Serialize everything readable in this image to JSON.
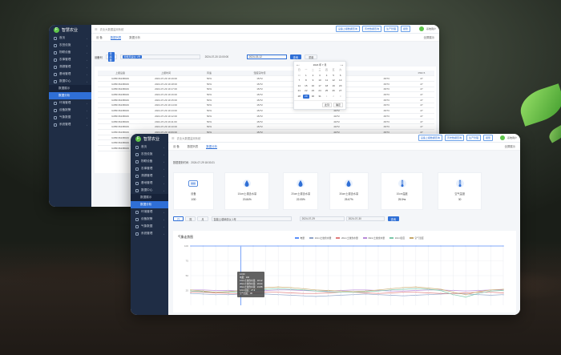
{
  "app": {
    "title": "智慧农业",
    "logo_letter": "F",
    "crumb": "农业大数据监测系统",
    "user": "系统用户",
    "fullscreen": "全屏展示"
  },
  "toolbar": [
    "设备上报数据查询",
    "历史数据查询",
    "生产管理",
    "报警"
  ],
  "menu": [
    {
      "label": "首页"
    },
    {
      "label": "农田设施"
    },
    {
      "label": "物联设备"
    },
    {
      "label": "农事管理"
    },
    {
      "label": "溯源管理"
    },
    {
      "label": "基地管理"
    },
    {
      "label": "数据中心",
      "expanded": true
    }
  ],
  "menu_sub": [
    {
      "label": "数据展示"
    },
    {
      "label": "数据分析",
      "active": true
    }
  ],
  "menu_after": [
    {
      "label": "环境管理"
    },
    {
      "label": "设备报警"
    },
    {
      "label": "气象数据"
    },
    {
      "label": "系统管理"
    }
  ],
  "back": {
    "tabs": [
      "设 备",
      "数据列表",
      "数据分析"
    ],
    "filter": {
      "device_label": "设备列",
      "device_tag": "传感器",
      "device_value": "智能风速仪 1号",
      "start": "2024-07-20 13:00:00",
      "end": "2024-03-12",
      "search": "查询",
      "reset": "重置"
    },
    "calendar": {
      "month": "2024 年 7 月",
      "weekdays": [
        "日",
        "一",
        "二",
        "三",
        "四",
        "五",
        "六"
      ],
      "days": [
        "30",
        "1",
        "2",
        "3",
        "4",
        "5",
        "6",
        "7",
        "8",
        "9",
        "10",
        "11",
        "12",
        "13",
        "14",
        "15",
        "16",
        "17",
        "18",
        "19",
        "20",
        "21",
        "22",
        "23",
        "24",
        "25",
        "26",
        "27",
        "28",
        "29",
        "30",
        "31",
        "1",
        "2",
        "3"
      ],
      "current": "29",
      "buttons": [
        "此刻",
        "确定"
      ]
    },
    "columns": [
      "上报设备",
      "上报时间",
      "风速",
      "湿度实时值",
      "",
      "风向实时值",
      "",
      "PM2.5"
    ],
    "rows": [
      [
        "GXBF3623B029",
        "2024-07-29 19:19:00",
        "50%",
        "15/72",
        "",
        "40/72",
        "15/73",
        "27"
      ],
      [
        "GXBF3623B029",
        "2024-07-29 19:18:00",
        "50%",
        "15/72",
        "",
        "40/72",
        "15/73",
        "27"
      ],
      [
        "GXBF3623B029",
        "2024-07-29 19:17:00",
        "50%",
        "15/72",
        "",
        "40/72",
        "15/73",
        "27"
      ],
      [
        "GXBF3623B029",
        "2024-07-29 19:16:00",
        "50%",
        "15/72",
        "",
        "40/72",
        "15/73",
        "27"
      ],
      [
        "GXBF3623B029",
        "2024-07-29 19:15:00",
        "50%",
        "15/72",
        "",
        "40/72",
        "15/73",
        "27"
      ],
      [
        "GXBF3623B029",
        "2024-07-29 19:14:00",
        "50%",
        "15/72",
        "",
        "40/72",
        "15/73",
        "27"
      ],
      [
        "GXBF3623B029",
        "2024-07-29 19:13:00",
        "50%",
        "15/72",
        "",
        "40/72",
        "15/73",
        "27"
      ],
      [
        "GXBF3623B029",
        "2024-07-29 19:12:00",
        "50%",
        "15/72",
        "",
        "40/72",
        "15/73",
        "27"
      ],
      [
        "GXBF3623B029",
        "2024-07-29 19:11:00",
        "50%",
        "15/72",
        "",
        "40/72",
        "15/73",
        "27"
      ],
      [
        "GXBF3623B029",
        "2024-07-29 19:10:00",
        "50%",
        "15/72",
        "",
        "40/72",
        "15/73",
        "27"
      ],
      [
        "GXBF3623B029",
        "2024-07-29 19:09:00",
        "50%",
        "15/72",
        "",
        "40/72",
        "15/73",
        "27"
      ],
      [
        "GXBF3623B029",
        "2024-07-29 19:08:00",
        "50%",
        "15/72",
        "",
        "40/72",
        "15/73",
        "27"
      ],
      [
        "GXBF3623B029",
        "2024-07-29 19:07:00",
        "50%",
        "15/72",
        "",
        "40/72",
        "15/73",
        "27"
      ],
      [
        "GXBF3623B029",
        "2024-07-29 19:06:00",
        "50%",
        "15/72",
        "",
        "40/72",
        "15/73",
        "27"
      ]
    ]
  },
  "front": {
    "tabs": [
      "设 备",
      "数据列表",
      "数据分析"
    ],
    "updated": "数据更新时间：2024-07-29 18:30:21",
    "cards": [
      {
        "icon": "device-icon",
        "label": "设备",
        "value": "1/30"
      },
      {
        "icon": "drop-icon",
        "label": "10cm土壤含水量",
        "value": "20.84%"
      },
      {
        "icon": "drop-icon",
        "label": "20cm土壤含水量",
        "value": "22.05%"
      },
      {
        "icon": "drop-icon",
        "label": "30cm土壤含水量",
        "value": "25.67%"
      },
      {
        "icon": "thermometer-icon",
        "label": "10cm温度",
        "value": "25.5℃"
      },
      {
        "icon": "thermometer-icon",
        "label": "空气温度",
        "value": "30"
      }
    ],
    "filter": {
      "ranges": [
        "日",
        "周",
        "月"
      ],
      "device": "智能土壤墒情仪 1号",
      "start": "2024-07-29",
      "end": "2024-07-30",
      "search": "查询"
    },
    "chart_title": "气象走势图",
    "legend": [
      "电量",
      "10cm土壤含水量",
      "20cm土壤含水量",
      "30cm土壤含水量",
      "10cm温度",
      "空气温度"
    ],
    "tooltip": [
      "10:00",
      "电量：100",
      "10cm土壤含水量：18.12",
      "20cm土壤含水量：20.04",
      "30cm土壤含水量：24.88",
      "10cm温度：27.9",
      "空气温度：30"
    ]
  },
  "chart_data": {
    "type": "line",
    "yticks": [
      "100",
      "75",
      "50",
      "25"
    ],
    "ylim": [
      0,
      100
    ],
    "series": [
      {
        "name": "电量",
        "color": "#5b8ff9",
        "values": [
          100,
          100,
          100,
          100,
          100,
          100,
          100,
          100,
          100,
          100,
          100,
          100,
          100,
          100,
          100,
          100,
          100,
          100,
          100,
          100,
          100,
          100,
          100,
          100,
          100,
          100
        ]
      },
      {
        "name": "10cm土壤含水量",
        "color": "#8fa3c7",
        "values": [
          20,
          19,
          18,
          18,
          19,
          20,
          19,
          18,
          17,
          16,
          15,
          16,
          17,
          18,
          19,
          18,
          17,
          16,
          17,
          18,
          19,
          20,
          19,
          18,
          17,
          18
        ]
      },
      {
        "name": "20cm土壤含水量",
        "color": "#e07b7b",
        "values": [
          22,
          22,
          21,
          20,
          20,
          21,
          22,
          22,
          21,
          20,
          20,
          21,
          22,
          22,
          21,
          20,
          21,
          22,
          22,
          21,
          20,
          20,
          21,
          22,
          22,
          21
        ]
      },
      {
        "name": "30cm土壤含水量",
        "color": "#b98ad8",
        "values": [
          26,
          26,
          25,
          25,
          24,
          24,
          25,
          26,
          26,
          25,
          24,
          24,
          25,
          26,
          26,
          25,
          24,
          24,
          25,
          26,
          26,
          25,
          24,
          25,
          26,
          26
        ]
      },
      {
        "name": "10cm温度",
        "color": "#7bc7a8",
        "values": [
          24,
          23,
          22,
          22,
          23,
          25,
          27,
          28,
          27,
          26,
          24,
          23,
          22,
          22,
          23,
          24,
          26,
          27,
          28,
          27,
          25,
          18,
          14,
          20,
          24,
          25
        ]
      },
      {
        "name": "空气温度",
        "color": "#c6a86b",
        "values": [
          26,
          24,
          22,
          23,
          25,
          28,
          30,
          31,
          30,
          28,
          26,
          25,
          24,
          23,
          24,
          26,
          28,
          30,
          31,
          29,
          27,
          22,
          18,
          23,
          26,
          27
        ]
      }
    ]
  },
  "colors": {
    "accent": "#2f6fd6",
    "sidebar": "#1f2d45"
  }
}
